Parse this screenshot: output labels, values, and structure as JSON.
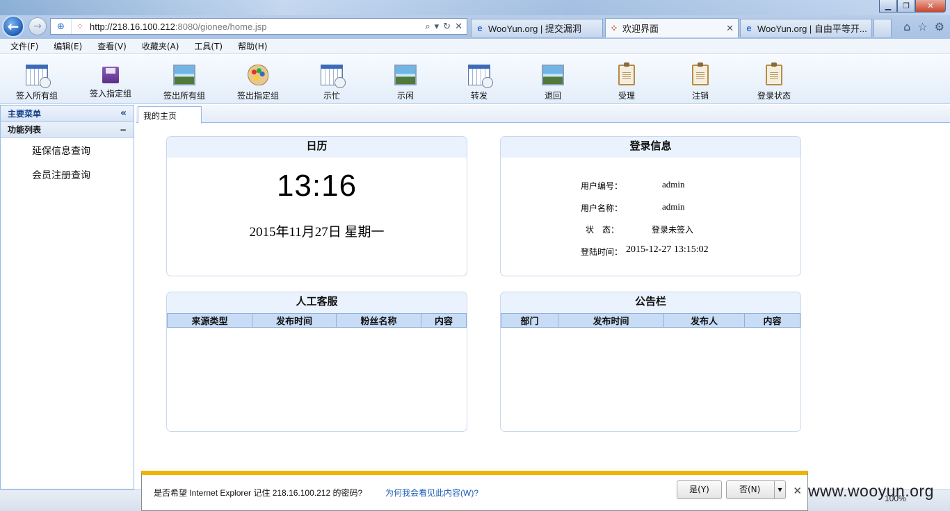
{
  "browser": {
    "address_url_main": "http://218.16.100.212",
    "address_url_rest": ":8080/gionee/home.jsp",
    "tabs": [
      {
        "title": "WooYun.org | 提交漏洞"
      },
      {
        "title": "欢迎界面"
      },
      {
        "title": "WooYun.org | 自由平等开..."
      }
    ]
  },
  "menu": [
    "文件(F)",
    "编辑(E)",
    "查看(V)",
    "收藏夹(A)",
    "工具(T)",
    "帮助(H)"
  ],
  "toolbar": [
    {
      "label": "签入所有组",
      "icon": "calendar-clock-icon"
    },
    {
      "label": "签入指定组",
      "icon": "save-disk-icon"
    },
    {
      "label": "签出所有组",
      "icon": "picture-icon"
    },
    {
      "label": "签出指定组",
      "icon": "palette-icon"
    },
    {
      "label": "示忙",
      "icon": "calendar-clock-icon"
    },
    {
      "label": "示闲",
      "icon": "picture-icon"
    },
    {
      "label": "转发",
      "icon": "calendar-clock-icon"
    },
    {
      "label": "退回",
      "icon": "picture-icon"
    },
    {
      "label": "受理",
      "icon": "clipboard-icon"
    },
    {
      "label": "注销",
      "icon": "clipboard-icon"
    },
    {
      "label": "登录状态",
      "icon": "clipboard-icon"
    }
  ],
  "sidebar": {
    "title": "主要菜单",
    "section": "功能列表",
    "items": [
      {
        "label": "延保信息查询"
      },
      {
        "label": "会员注册查询"
      }
    ]
  },
  "main": {
    "tab": "我的主页",
    "calendar": {
      "title": "日历",
      "time": "13:16",
      "date": "2015年11月27日 星期一"
    },
    "login": {
      "title": "登录信息",
      "user_id_label": "用户编号：",
      "user_id": "admin",
      "user_name_label": "用户名称：",
      "user_name": "admin",
      "status_label": "状　态：",
      "status": "登录未签入",
      "login_time_label": "登陆时间：",
      "login_time": "2015-12-27 13:15:02"
    },
    "service": {
      "title": "人工客服",
      "columns": [
        "来源类型",
        "发布时间",
        "粉丝名称",
        "内容"
      ]
    },
    "notice": {
      "title": "公告栏",
      "columns": [
        "部门",
        "发布时间",
        "发布人",
        "内容"
      ]
    }
  },
  "notification": {
    "message": "是否希望 Internet Explorer 记住 218.16.100.212 的密码?",
    "why_link": "为何我会看见此内容(W)?",
    "yes": "是(Y)",
    "no": "否(N)"
  },
  "status": {
    "zoom": "100%",
    "watermark": "www.wooyun.org"
  }
}
